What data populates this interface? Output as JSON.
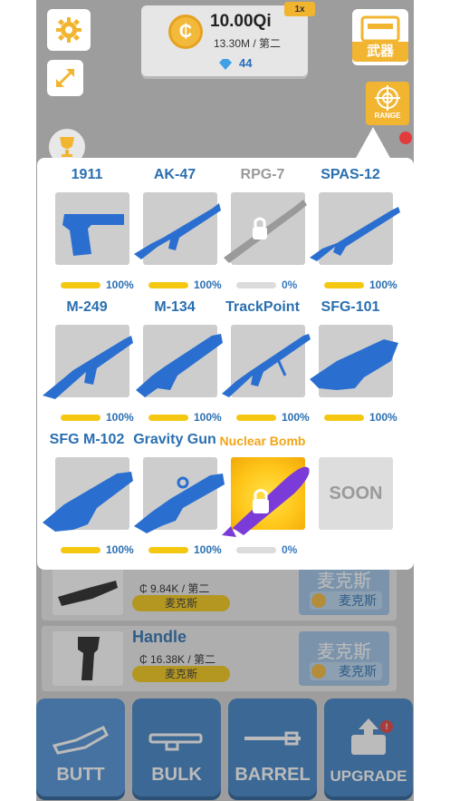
{
  "header": {
    "coins": "10.00Qi",
    "coin_rate": "13.30M / 第二",
    "gems": "44",
    "multiplier": "1x",
    "weapons_label": "武器",
    "range_label": "RANGE",
    "coin_symbol": "₵"
  },
  "weapons": [
    {
      "name": "1911",
      "progress": 100,
      "progress_label": "100%",
      "state": "owned"
    },
    {
      "name": "AK-47",
      "progress": 100,
      "progress_label": "100%",
      "state": "owned"
    },
    {
      "name": "RPG-7",
      "progress": 0,
      "progress_label": "0%",
      "state": "locked"
    },
    {
      "name": "SPAS-12",
      "progress": 100,
      "progress_label": "100%",
      "state": "owned"
    },
    {
      "name": "M-249",
      "progress": 100,
      "progress_label": "100%",
      "state": "owned"
    },
    {
      "name": "M-134",
      "progress": 100,
      "progress_label": "100%",
      "state": "owned"
    },
    {
      "name": "TrackPoint",
      "progress": 100,
      "progress_label": "100%",
      "state": "owned"
    },
    {
      "name": "SFG-101",
      "progress": 100,
      "progress_label": "100%",
      "state": "owned"
    },
    {
      "name": "SFG M-102",
      "progress": 100,
      "progress_label": "100%",
      "state": "owned"
    },
    {
      "name": "Gravity Gun",
      "progress": 100,
      "progress_label": "100%",
      "state": "owned"
    },
    {
      "name": "Nuclear Bomb",
      "progress": 0,
      "progress_label": "0%",
      "state": "locked-special"
    },
    {
      "name": "",
      "soon_label": "SOON",
      "state": "soon"
    }
  ],
  "parts_list": [
    {
      "title": "",
      "price": "9.84K / 第二",
      "tag": "麦克斯",
      "button_title": "麦克斯",
      "button_sub": "麦克斯"
    },
    {
      "title": "Handle",
      "price": "16.38K / 第二",
      "tag": "麦克斯",
      "button_title": "麦克斯",
      "button_sub": "麦克斯"
    }
  ],
  "tabs": [
    {
      "label": "BUTT",
      "active": true
    },
    {
      "label": "BULK",
      "active": false
    },
    {
      "label": "BARREL",
      "active": false
    },
    {
      "label": "UPGRADE",
      "active": false,
      "badge": "!"
    }
  ],
  "colors": {
    "accent_blue": "#2a6fb0",
    "gold": "#f2b531",
    "progress_yellow": "#f4c811",
    "tab_blue": "#3d80c5"
  }
}
